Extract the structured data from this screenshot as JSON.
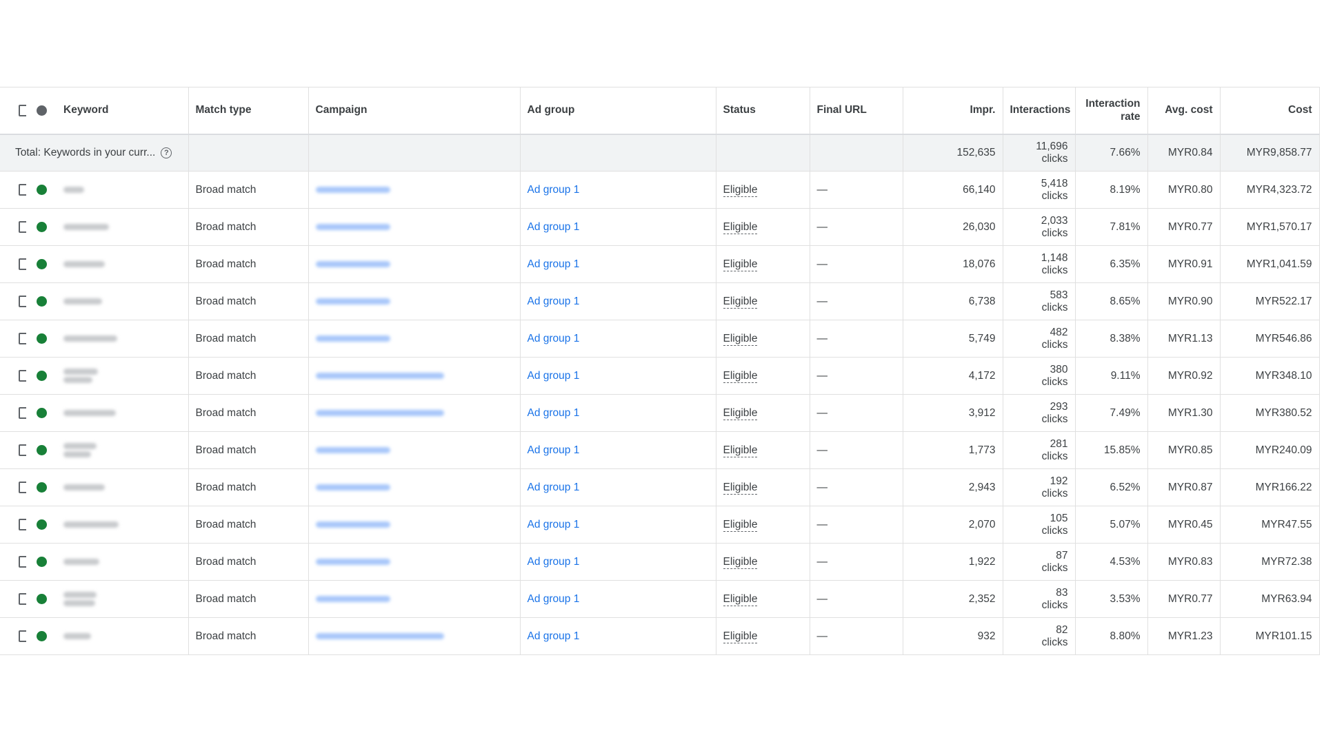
{
  "headers": {
    "keyword": "Keyword",
    "match_type": "Match type",
    "campaign": "Campaign",
    "ad_group": "Ad group",
    "status": "Status",
    "final_url": "Final URL",
    "impr": "Impr.",
    "interactions": "Interactions",
    "interaction_rate": "Interaction rate",
    "avg_cost": "Avg. cost",
    "cost": "Cost"
  },
  "total": {
    "label": "Total: Keywords in your curr...",
    "impr": "152,635",
    "interactions": "11,696",
    "interactions_unit": "clicks",
    "interaction_rate": "7.66%",
    "avg_cost": "MYR0.84",
    "cost": "MYR9,858.77"
  },
  "colors": {
    "status_enabled": "#188038",
    "link": "#1a73e8"
  },
  "rows": [
    {
      "match_type": "Broad match",
      "ad_group": "Ad group 1",
      "status": "Eligible",
      "final_url": "—",
      "impr": "66,140",
      "interactions": "5,418",
      "unit": "clicks",
      "interaction_rate": "8.19%",
      "avg_cost": "MYR0.80",
      "cost": "MYR4,323.72"
    },
    {
      "match_type": "Broad match",
      "ad_group": "Ad group 1",
      "status": "Eligible",
      "final_url": "—",
      "impr": "26,030",
      "interactions": "2,033",
      "unit": "clicks",
      "interaction_rate": "7.81%",
      "avg_cost": "MYR0.77",
      "cost": "MYR1,570.17"
    },
    {
      "match_type": "Broad match",
      "ad_group": "Ad group 1",
      "status": "Eligible",
      "final_url": "—",
      "impr": "18,076",
      "interactions": "1,148",
      "unit": "clicks",
      "interaction_rate": "6.35%",
      "avg_cost": "MYR0.91",
      "cost": "MYR1,041.59"
    },
    {
      "match_type": "Broad match",
      "ad_group": "Ad group 1",
      "status": "Eligible",
      "final_url": "—",
      "impr": "6,738",
      "interactions": "583",
      "unit": "clicks",
      "interaction_rate": "8.65%",
      "avg_cost": "MYR0.90",
      "cost": "MYR522.17"
    },
    {
      "match_type": "Broad match",
      "ad_group": "Ad group 1",
      "status": "Eligible",
      "final_url": "—",
      "impr": "5,749",
      "interactions": "482",
      "unit": "clicks",
      "interaction_rate": "8.38%",
      "avg_cost": "MYR1.13",
      "cost": "MYR546.86"
    },
    {
      "match_type": "Broad match",
      "ad_group": "Ad group 1",
      "status": "Eligible",
      "final_url": "—",
      "impr": "4,172",
      "interactions": "380",
      "unit": "clicks",
      "interaction_rate": "9.11%",
      "avg_cost": "MYR0.92",
      "cost": "MYR348.10"
    },
    {
      "match_type": "Broad match",
      "ad_group": "Ad group 1",
      "status": "Eligible",
      "final_url": "—",
      "impr": "3,912",
      "interactions": "293",
      "unit": "clicks",
      "interaction_rate": "7.49%",
      "avg_cost": "MYR1.30",
      "cost": "MYR380.52"
    },
    {
      "match_type": "Broad match",
      "ad_group": "Ad group 1",
      "status": "Eligible",
      "final_url": "—",
      "impr": "1,773",
      "interactions": "281",
      "unit": "clicks",
      "interaction_rate": "15.85%",
      "avg_cost": "MYR0.85",
      "cost": "MYR240.09"
    },
    {
      "match_type": "Broad match",
      "ad_group": "Ad group 1",
      "status": "Eligible",
      "final_url": "—",
      "impr": "2,943",
      "interactions": "192",
      "unit": "clicks",
      "interaction_rate": "6.52%",
      "avg_cost": "MYR0.87",
      "cost": "MYR166.22"
    },
    {
      "match_type": "Broad match",
      "ad_group": "Ad group 1",
      "status": "Eligible",
      "final_url": "—",
      "impr": "2,070",
      "interactions": "105",
      "unit": "clicks",
      "interaction_rate": "5.07%",
      "avg_cost": "MYR0.45",
      "cost": "MYR47.55"
    },
    {
      "match_type": "Broad match",
      "ad_group": "Ad group 1",
      "status": "Eligible",
      "final_url": "—",
      "impr": "1,922",
      "interactions": "87",
      "unit": "clicks",
      "interaction_rate": "4.53%",
      "avg_cost": "MYR0.83",
      "cost": "MYR72.38"
    },
    {
      "match_type": "Broad match",
      "ad_group": "Ad group 1",
      "status": "Eligible",
      "final_url": "—",
      "impr": "2,352",
      "interactions": "83",
      "unit": "clicks",
      "interaction_rate": "3.53%",
      "avg_cost": "MYR0.77",
      "cost": "MYR63.94"
    },
    {
      "match_type": "Broad match",
      "ad_group": "Ad group 1",
      "status": "Eligible",
      "final_url": "—",
      "impr": "932",
      "interactions": "82",
      "unit": "clicks",
      "interaction_rate": "8.80%",
      "avg_cost": "MYR1.23",
      "cost": "MYR101.15"
    }
  ]
}
